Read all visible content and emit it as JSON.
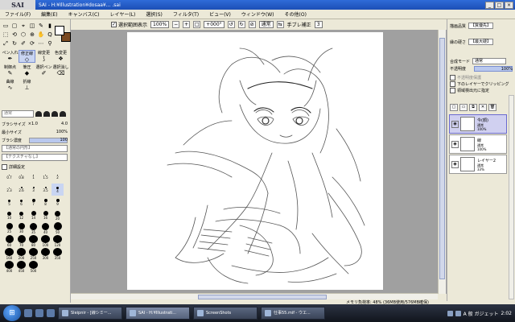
{
  "window": {
    "logo": "SAI",
    "title": "SAI - H:¥Illustration¥dosaa¥... .sai",
    "buttons": [
      "_",
      "□",
      "×"
    ]
  },
  "menu": [
    "ファイル(F)",
    "編集(E)",
    "キャンバス(C)",
    "レイヤー(L)",
    "選択(S)",
    "フィルタ(T)",
    "ビュー(V)",
    "ウィンドウ(W)",
    "その他(O)"
  ],
  "toolbar": {
    "selection_label": "選択範囲表示",
    "selection_checked": true,
    "zoom": "100%",
    "rotation": "+000°",
    "blend": "通常",
    "stabilizer_label": "手ブレ補正",
    "stabilizer_value": "3"
  },
  "tools": {
    "icons": [
      "▭",
      "▢",
      "⌖",
      "◫",
      "✎",
      "▮",
      "⬚",
      "⟲",
      "⬡",
      "⊕",
      "✋",
      "Q",
      "⤢",
      "↻",
      "✐",
      "⟳",
      "⋯",
      "⚲"
    ],
    "tabs": [
      {
        "label": "ペン入れ",
        "glyph": "✒",
        "selected": false
      },
      {
        "label": "修正線",
        "glyph": "◇",
        "selected": true
      },
      {
        "label": "線変更",
        "glyph": "⟆",
        "selected": false
      },
      {
        "label": "色変更",
        "glyph": "❖",
        "selected": false
      },
      {
        "label": "制御点",
        "glyph": "✎",
        "selected": false
      },
      {
        "label": "筆圧",
        "glyph": "◆",
        "selected": false
      },
      {
        "label": "選択ペン",
        "glyph": "✐",
        "selected": false
      },
      {
        "label": "選択消し",
        "glyph": "⌫",
        "selected": false
      },
      {
        "label": "曲線",
        "glyph": "∿",
        "selected": false
      },
      {
        "label": "折線",
        "glyph": "⊥",
        "selected": false
      }
    ],
    "mode_box": "通常"
  },
  "brush": {
    "size_label": "ブラシサイズ",
    "size_mult": "×1.0",
    "size_value": "4.0",
    "min_label": "最小サイズ",
    "min_value": "100%",
    "density_label": "ブラシ濃度",
    "density_value": "100",
    "density_fraction": 1.0,
    "combo1": "【通常の円形】",
    "combo2": "【テクスチャなし】",
    "detail_label": "詳細設定",
    "presets": [
      {
        "label": "0.7",
        "d": 1
      },
      {
        "label": "0.8",
        "d": 1
      },
      {
        "label": "1",
        "d": 1
      },
      {
        "label": "1.5",
        "d": 1
      },
      {
        "label": "2",
        "d": 1
      },
      {
        "label": "2.3",
        "d": 1
      },
      {
        "label": "2.6",
        "d": 2
      },
      {
        "label": "3",
        "d": 2
      },
      {
        "label": "3.5",
        "d": 2
      },
      {
        "label": "4",
        "d": 3
      },
      {
        "label": "5",
        "d": 3
      },
      {
        "label": "6",
        "d": 3
      },
      {
        "label": "7",
        "d": 4
      },
      {
        "label": "8",
        "d": 4
      },
      {
        "label": "9",
        "d": 4
      },
      {
        "label": "10",
        "d": 5
      },
      {
        "label": "12",
        "d": 5
      },
      {
        "label": "14",
        "d": 6
      },
      {
        "label": "16",
        "d": 6
      },
      {
        "label": "20",
        "d": 7
      },
      {
        "label": "25",
        "d": 8
      },
      {
        "label": "30",
        "d": 8
      },
      {
        "label": "35",
        "d": 9
      },
      {
        "label": "40",
        "d": 9
      },
      {
        "label": "50",
        "d": 10
      },
      {
        "label": "60",
        "d": 10
      },
      {
        "label": "70",
        "d": 10
      },
      {
        "label": "80",
        "d": 11
      },
      {
        "label": "100",
        "d": 11
      },
      {
        "label": "120",
        "d": 11
      },
      {
        "label": "160",
        "d": 11
      },
      {
        "label": "200",
        "d": 11
      },
      {
        "label": "250",
        "d": 11
      },
      {
        "label": "300",
        "d": 11
      },
      {
        "label": "350",
        "d": 11
      },
      {
        "label": "400",
        "d": 11
      },
      {
        "label": "450",
        "d": 11
      },
      {
        "label": "500",
        "d": 11
      }
    ],
    "selected_preset": 9
  },
  "right_panel": {
    "quality_label": "描画品質",
    "quality_value": "【質優先】",
    "edge_label": "縁の硬さ",
    "edge_value": "【最大硬】",
    "blend_label": "合成モード",
    "blend_value": "通常",
    "opacity_label": "不透明度",
    "opacity_value": "100%",
    "opacity_fraction": 1.0,
    "opt1": "不透明度保護",
    "opt2": "下のレイヤーでクリッピング",
    "opt3": "領域検出元に指定",
    "layers": [
      {
        "name": "今(顔)",
        "mode": "通常",
        "opacity": "100%",
        "selected": true
      },
      {
        "name": "線",
        "mode": "通常",
        "opacity": "100%",
        "selected": false
      },
      {
        "name": "レイヤー2",
        "mode": "通常",
        "opacity": "33%",
        "selected": false
      }
    ]
  },
  "status": "メモリ負荷率: 48% (36MB使用/576MB確保)",
  "taskbar": {
    "start": "⊞",
    "tasks": [
      {
        "label": "Sleipnir - [線シミー...",
        "active": false
      },
      {
        "label": "SAI - H:¥Illustrati...",
        "active": true
      },
      {
        "label": "ScreenShots",
        "active": false
      },
      {
        "label": "仕事55.mif - ウエ...",
        "active": false
      }
    ],
    "tray_text": "A 般 ガジェット",
    "clock": "2:02"
  }
}
